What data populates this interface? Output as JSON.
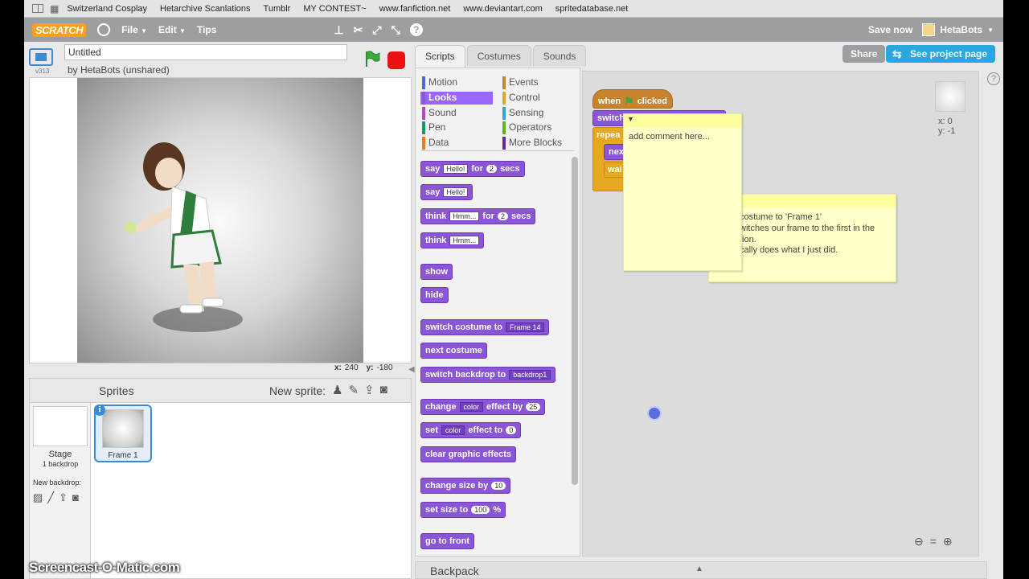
{
  "bookmarks": [
    "Switzerland Cosplay",
    "Hetarchive Scanlations",
    "Tumblr",
    "MY CONTEST~",
    "www.fanfiction.net",
    "www.deviantart.com",
    "spritedatabase.net"
  ],
  "topbar": {
    "logo": "SCRATCH",
    "menus": [
      "File",
      "Edit",
      "Tips"
    ],
    "save_now": "Save now",
    "username": "HetaBots"
  },
  "stage": {
    "version": "v313",
    "project_title": "Untitled",
    "byline": "by HetaBots (unshared)",
    "mouse_x_label": "x:",
    "mouse_x": "240",
    "mouse_y_label": "y:",
    "mouse_y": "-180"
  },
  "sprites": {
    "title": "Sprites",
    "new_sprite": "New sprite:",
    "stage_label": "Stage",
    "stage_sub": "1 backdrop",
    "new_backdrop": "New backdrop:",
    "sprite_name": "Frame 1"
  },
  "tabs": [
    "Scripts",
    "Costumes",
    "Sounds"
  ],
  "actions": {
    "share": "Share",
    "project_page": "See project page"
  },
  "categories": [
    {
      "label": "Motion",
      "color": "#4a6cd4"
    },
    {
      "label": "Looks",
      "color": "#8a55d7"
    },
    {
      "label": "Sound",
      "color": "#bb42c3"
    },
    {
      "label": "Pen",
      "color": "#0e9a6c"
    },
    {
      "label": "Data",
      "color": "#ee7d16"
    },
    {
      "label": "Events",
      "color": "#c88330"
    },
    {
      "label": "Control",
      "color": "#e1a91a"
    },
    {
      "label": "Sensing",
      "color": "#2ca5e2"
    },
    {
      "label": "Operators",
      "color": "#5cb712"
    },
    {
      "label": "More Blocks",
      "color": "#632d99"
    }
  ],
  "blocks": {
    "say_secs": {
      "a": "say",
      "input": "Hello!",
      "b": "for",
      "num": "2",
      "c": "secs"
    },
    "say": {
      "a": "say",
      "input": "Hello!"
    },
    "think_secs": {
      "a": "think",
      "input": "Hmm...",
      "b": "for",
      "num": "2",
      "c": "secs"
    },
    "think": {
      "a": "think",
      "input": "Hmm..."
    },
    "show": "show",
    "hide": "hide",
    "switch_costume": {
      "a": "switch costume to",
      "dd": "Frame 14"
    },
    "next_costume": "next costume",
    "switch_backdrop": {
      "a": "switch backdrop to",
      "dd": "backdrop1"
    },
    "change_effect": {
      "a": "change",
      "dd": "color",
      "b": "effect by",
      "num": "25"
    },
    "set_effect": {
      "a": "set",
      "dd": "color",
      "b": "effect to",
      "num": "0"
    },
    "clear_effects": "clear graphic effects",
    "change_size": {
      "a": "change size by",
      "num": "10"
    },
    "set_size": {
      "a": "set size to",
      "num": "100",
      "b": "%"
    },
    "go_front": "go to front"
  },
  "script": {
    "hat_a": "when",
    "hat_b": "clicked",
    "switch": "switch",
    "repeat": "repea",
    "next": "nex",
    "wait": "wai"
  },
  "comments": {
    "new": "add comment here...",
    "note_lines": [
      "costume to 'Frame 1'",
      "witches our frame to the first in the",
      "tion.",
      "cally does what I just did."
    ]
  },
  "sprite_info": {
    "x": "x: 0",
    "y": "y: -1"
  },
  "backpack": "Backpack",
  "watermark": "Screencast-O-Matic.com"
}
